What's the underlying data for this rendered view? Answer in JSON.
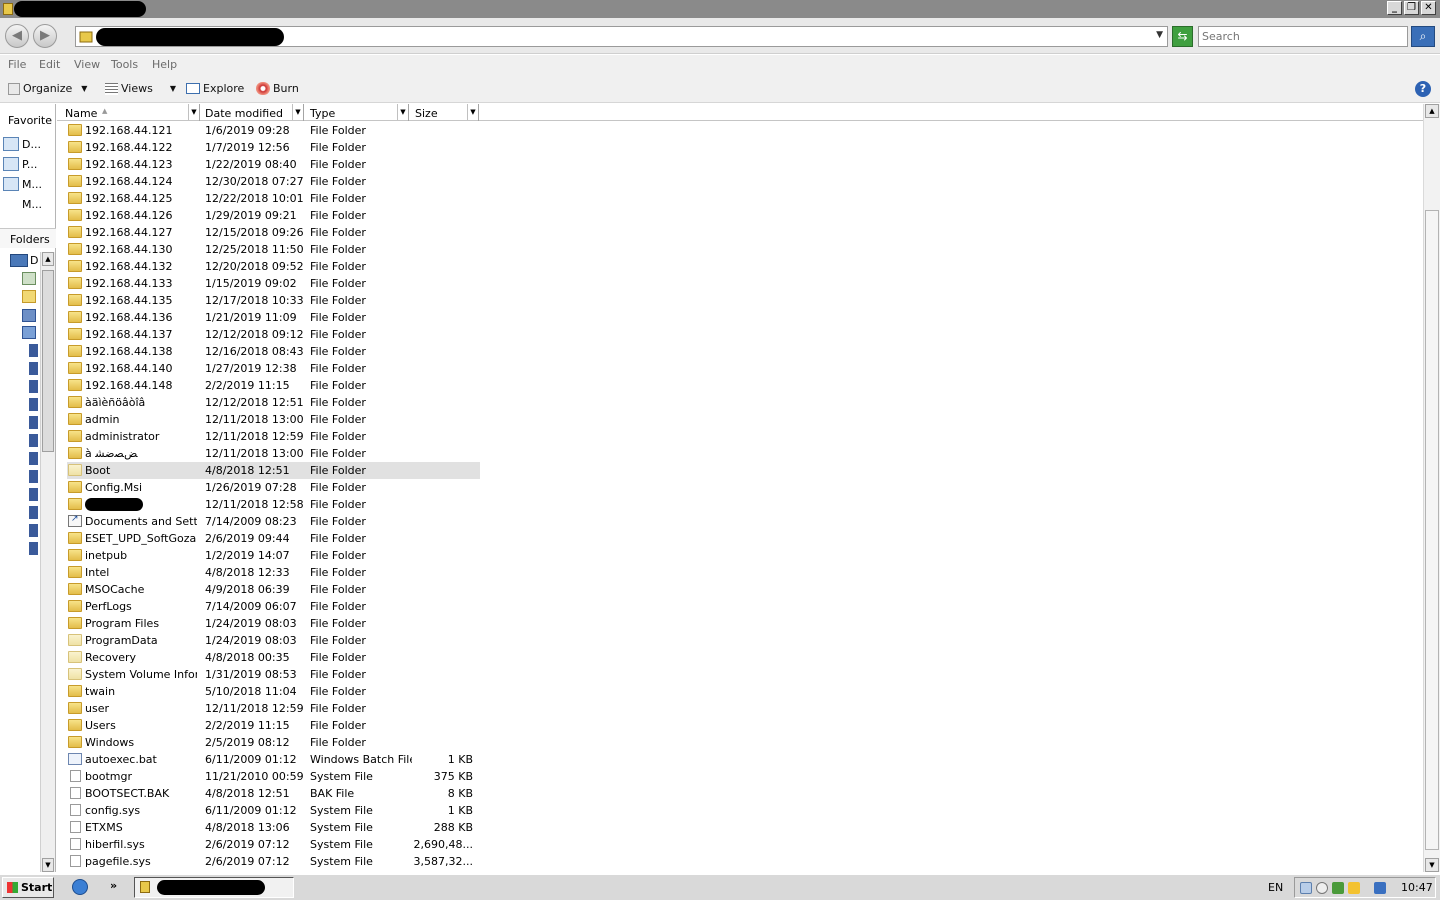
{
  "titlebar": {
    "minimize": "_",
    "restore": "❐",
    "close": "✕"
  },
  "address": {
    "dropdown": "▼"
  },
  "search": {
    "placeholder": "Search"
  },
  "menu": [
    "File",
    "Edit",
    "View",
    "Tools",
    "Help"
  ],
  "toolbar": {
    "organize": "Organize",
    "views": "Views",
    "explore": "Explore",
    "burn": "Burn",
    "help": "?"
  },
  "navpane": {
    "favorites_title": "Favorite L",
    "favorites": [
      "D...",
      "P...",
      "M...",
      "M..."
    ],
    "folders_title": "Folders",
    "tree_root": "D"
  },
  "columns": {
    "name": "Name",
    "date": "Date modified",
    "type": "Type",
    "size": "Size"
  },
  "rows": [
    {
      "icon": "folder",
      "name": "192.168.44.121",
      "date": "1/6/2019 09:28",
      "type": "File Folder",
      "size": ""
    },
    {
      "icon": "folder",
      "name": "192.168.44.122",
      "date": "1/7/2019 12:56",
      "type": "File Folder",
      "size": ""
    },
    {
      "icon": "folder",
      "name": "192.168.44.123",
      "date": "1/22/2019 08:40",
      "type": "File Folder",
      "size": ""
    },
    {
      "icon": "folder",
      "name": "192.168.44.124",
      "date": "12/30/2018 07:27",
      "type": "File Folder",
      "size": ""
    },
    {
      "icon": "folder",
      "name": "192.168.44.125",
      "date": "12/22/2018 10:01",
      "type": "File Folder",
      "size": ""
    },
    {
      "icon": "folder",
      "name": "192.168.44.126",
      "date": "1/29/2019 09:21",
      "type": "File Folder",
      "size": ""
    },
    {
      "icon": "folder",
      "name": "192.168.44.127",
      "date": "12/15/2018 09:26",
      "type": "File Folder",
      "size": ""
    },
    {
      "icon": "folder",
      "name": "192.168.44.130",
      "date": "12/25/2018 11:50",
      "type": "File Folder",
      "size": ""
    },
    {
      "icon": "folder",
      "name": "192.168.44.132",
      "date": "12/20/2018 09:52",
      "type": "File Folder",
      "size": ""
    },
    {
      "icon": "folder",
      "name": "192.168.44.133",
      "date": "1/15/2019 09:02",
      "type": "File Folder",
      "size": ""
    },
    {
      "icon": "folder",
      "name": "192.168.44.135",
      "date": "12/17/2018 10:33",
      "type": "File Folder",
      "size": ""
    },
    {
      "icon": "folder",
      "name": "192.168.44.136",
      "date": "1/21/2019 11:09",
      "type": "File Folder",
      "size": ""
    },
    {
      "icon": "folder",
      "name": "192.168.44.137",
      "date": "12/12/2018 09:12",
      "type": "File Folder",
      "size": ""
    },
    {
      "icon": "folder",
      "name": "192.168.44.138",
      "date": "12/16/2018 08:43",
      "type": "File Folder",
      "size": ""
    },
    {
      "icon": "folder",
      "name": "192.168.44.140",
      "date": "1/27/2019 12:38",
      "type": "File Folder",
      "size": ""
    },
    {
      "icon": "folder",
      "name": "192.168.44.148",
      "date": "2/2/2019 11:15",
      "type": "File Folder",
      "size": ""
    },
    {
      "icon": "folder",
      "name": "àäìèñöâòîâ",
      "date": "12/12/2018 12:51",
      "type": "File Folder",
      "size": ""
    },
    {
      "icon": "folder",
      "name": "admin",
      "date": "12/11/2018 13:00",
      "type": "File Folder",
      "size": ""
    },
    {
      "icon": "folder",
      "name": "administrator",
      "date": "12/11/2018 12:59",
      "type": "File Folder",
      "size": ""
    },
    {
      "icon": "folder",
      "name": "à ﺾﺼﺿﺸ",
      "date": "12/11/2018 13:00",
      "type": "File Folder",
      "size": ""
    },
    {
      "icon": "folder-locked",
      "name": "Boot",
      "date": "4/8/2018 12:51",
      "type": "File Folder",
      "size": "",
      "selected": true
    },
    {
      "icon": "folder",
      "name": "Config.Msi",
      "date": "1/26/2019 07:28",
      "type": "File Folder",
      "size": ""
    },
    {
      "icon": "folder",
      "name": "",
      "redacted": true,
      "date": "12/11/2018 12:58",
      "type": "File Folder",
      "size": ""
    },
    {
      "icon": "shortcut",
      "name": "Documents and Setti...",
      "date": "7/14/2009 08:23",
      "type": "File Folder",
      "size": ""
    },
    {
      "icon": "folder",
      "name": "ESET_UPD_SoftGozar",
      "date": "2/6/2019 09:44",
      "type": "File Folder",
      "size": ""
    },
    {
      "icon": "folder",
      "name": "inetpub",
      "date": "1/2/2019 14:07",
      "type": "File Folder",
      "size": ""
    },
    {
      "icon": "folder",
      "name": "Intel",
      "date": "4/8/2018 12:33",
      "type": "File Folder",
      "size": ""
    },
    {
      "icon": "folder",
      "name": "MSOCache",
      "date": "4/9/2018 06:39",
      "type": "File Folder",
      "size": ""
    },
    {
      "icon": "folder",
      "name": "PerfLogs",
      "date": "7/14/2009 06:07",
      "type": "File Folder",
      "size": ""
    },
    {
      "icon": "folder",
      "name": "Program Files",
      "date": "1/24/2019 08:03",
      "type": "File Folder",
      "size": ""
    },
    {
      "icon": "folder-locked",
      "name": "ProgramData",
      "date": "1/24/2019 08:03",
      "type": "File Folder",
      "size": ""
    },
    {
      "icon": "folder-locked",
      "name": "Recovery",
      "date": "4/8/2018 00:35",
      "type": "File Folder",
      "size": ""
    },
    {
      "icon": "folder-locked",
      "name": "System Volume Infor...",
      "date": "1/31/2019 08:53",
      "type": "File Folder",
      "size": ""
    },
    {
      "icon": "folder",
      "name": "twain",
      "date": "5/10/2018 11:04",
      "type": "File Folder",
      "size": ""
    },
    {
      "icon": "folder",
      "name": "user",
      "date": "12/11/2018 12:59",
      "type": "File Folder",
      "size": ""
    },
    {
      "icon": "folder",
      "name": "Users",
      "date": "2/2/2019 11:15",
      "type": "File Folder",
      "size": ""
    },
    {
      "icon": "folder",
      "name": "Windows",
      "date": "2/5/2019 08:12",
      "type": "File Folder",
      "size": ""
    },
    {
      "icon": "batch",
      "name": "autoexec.bat",
      "date": "6/11/2009 01:12",
      "type": "Windows Batch File",
      "size": "1 KB"
    },
    {
      "icon": "file",
      "name": "bootmgr",
      "date": "11/21/2010 00:59",
      "type": "System File",
      "size": "375 KB"
    },
    {
      "icon": "file",
      "name": "BOOTSECT.BAK",
      "date": "4/8/2018 12:51",
      "type": "BAK File",
      "size": "8 KB"
    },
    {
      "icon": "file",
      "name": "config.sys",
      "date": "6/11/2009 01:12",
      "type": "System File",
      "size": "1 KB"
    },
    {
      "icon": "file",
      "name": "ETXMS",
      "date": "4/8/2018 13:06",
      "type": "System File",
      "size": "288 KB"
    },
    {
      "icon": "file",
      "name": "hiberfil.sys",
      "date": "2/6/2019 07:12",
      "type": "System File",
      "size": "2,690,48..."
    },
    {
      "icon": "file",
      "name": "pagefile.sys",
      "date": "2/6/2019 07:12",
      "type": "System File",
      "size": "3,587,32..."
    }
  ],
  "taskbar": {
    "start": "Start",
    "quicklaunch_more": "»",
    "language": "EN",
    "clock": "10:47"
  },
  "colors": {
    "selection": "#e1e1e1",
    "titlebar": "#8a8a8a",
    "folder": "#e3bd4a"
  }
}
